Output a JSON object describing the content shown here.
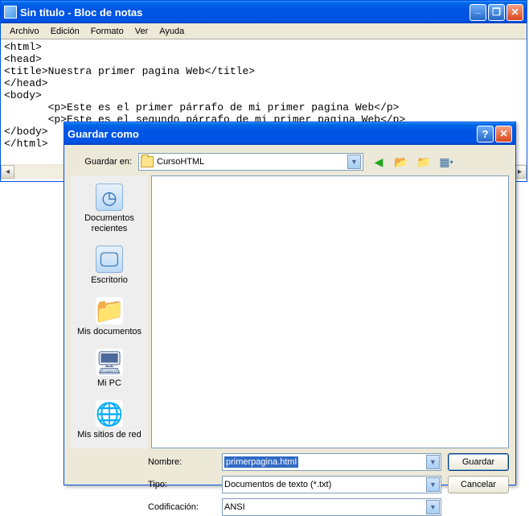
{
  "notepad": {
    "title": "Sin título - Bloc de notas",
    "menu": {
      "file": "Archivo",
      "edit": "Edición",
      "format": "Formato",
      "view": "Ver",
      "help": "Ayuda"
    },
    "content": "<html>\n<head>\n<title>Nuestra primer pagina Web</title>\n</head>\n<body>\n       <p>Este es el primer párrafo de mi primer pagina Web</p>\n       <p>Este es el segundo párrafo de mi primer pagina Web</p>\n</body>\n</html>"
  },
  "dialog": {
    "title": "Guardar como",
    "save_in_label": "Guardar en:",
    "save_in_value": "CursoHTML",
    "places": {
      "recent": "Documentos recientes",
      "desktop": "Escritorio",
      "mydocs": "Mis documentos",
      "mypc": "Mi PC",
      "network": "Mis sitios de red"
    },
    "name_label": "Nombre:",
    "name_value": "primerpagina.html",
    "type_label": "Tipo:",
    "type_value": "Documentos de texto (*.txt)",
    "encoding_label": "Codificación:",
    "encoding_value": "ANSI",
    "save_btn": "Guardar",
    "cancel_btn": "Cancelar",
    "help": "?"
  },
  "winctrls": {
    "min": "_",
    "max": "❐",
    "close": "✕"
  }
}
